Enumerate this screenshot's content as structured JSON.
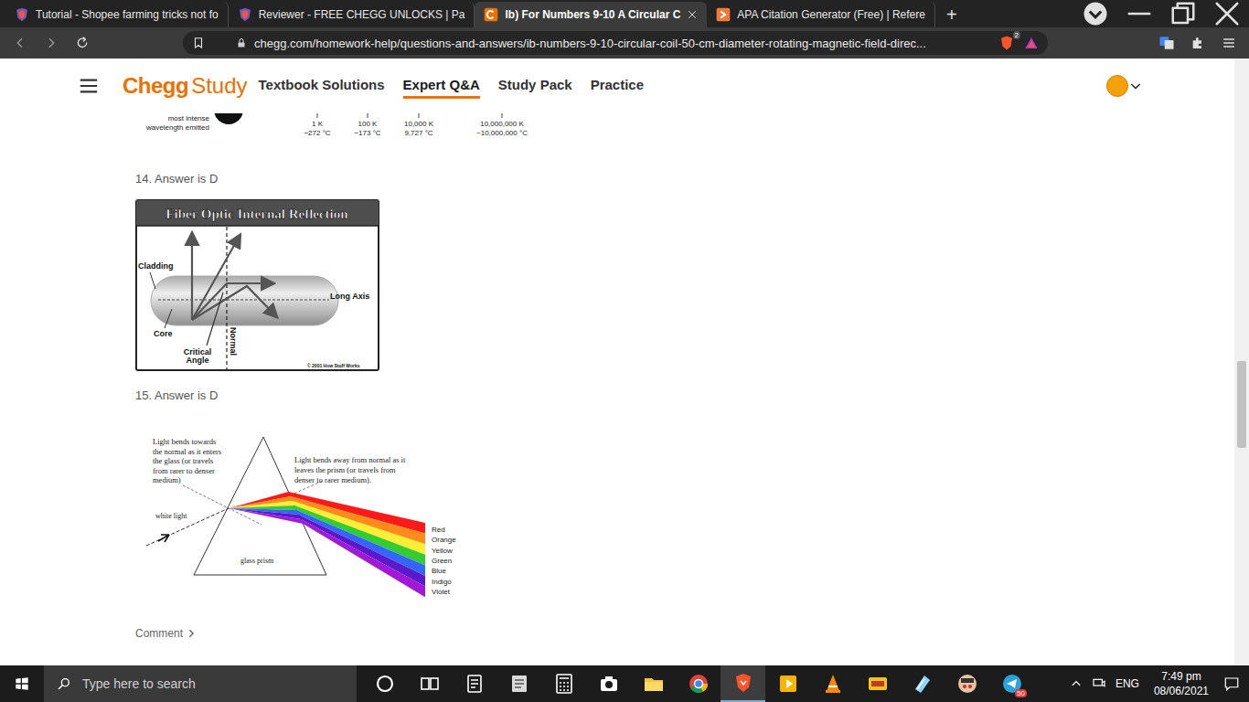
{
  "browser": {
    "tabs": [
      {
        "label": "Tutorial - Shopee farming tricks not fo",
        "selected": false,
        "kind": "brave"
      },
      {
        "label": "Reviewer - FREE CHEGG UNLOCKS | Pa",
        "selected": false,
        "kind": "brave"
      },
      {
        "label": "Ib) For Numbers 9-10 A Circular C",
        "selected": true,
        "kind": "chegg"
      },
      {
        "label": "APA Citation Generator (Free) | Refere",
        "selected": false,
        "kind": "scribbr"
      }
    ],
    "new_tab": "+",
    "url": "chegg.com/homework-help/questions-and-answers/ib-numbers-9-10-circular-coil-50-cm-diameter-rotating-magnetic-field-direc...",
    "shield_badge": "2"
  },
  "header": {
    "logo": "Chegg",
    "logo_sub": "Study",
    "nav": [
      {
        "label": "Textbook Solutions",
        "selected": false
      },
      {
        "label": "Expert Q&A",
        "selected": true
      },
      {
        "label": "Study Pack",
        "selected": false
      },
      {
        "label": "Practice",
        "selected": false
      }
    ]
  },
  "content": {
    "spectrum": {
      "caption": [
        "most intense",
        "wavelength emitted"
      ],
      "ticks": [
        {
          "kelvin": "1 K",
          "celsius": "−272 °C"
        },
        {
          "kelvin": "100 K",
          "celsius": "−173 °C"
        },
        {
          "kelvin": "10,000 K",
          "celsius": "9,727 °C"
        },
        {
          "kelvin": "10,000,000 K",
          "celsius": "~10,000,000 °C"
        }
      ]
    },
    "answers": [
      {
        "label": "14. Answer is D"
      },
      {
        "label": "15. Answer is D"
      }
    ],
    "fiber_figure": {
      "title": "Fiber Optic Internal Reflection",
      "cladding": "Cladding",
      "core": "Core",
      "critical_angle": [
        "Critical",
        "Angle"
      ],
      "normal": "Normal",
      "long_axis": "Long Axis",
      "credit": "© 2001 How Stuff Works"
    },
    "prism_figure": {
      "enter_note": [
        "Light bends towards",
        "the normal as it enters",
        "the glass (or travels",
        "from rarer to denser",
        "medium)"
      ],
      "exit_note": [
        "Light bends away from normal as it",
        "leaves the prism (or travels from",
        "denser to rarer medium)."
      ],
      "white_light": "white light",
      "prism": "glass prism",
      "colors": [
        {
          "name": "Red",
          "color": "#ff1a1a"
        },
        {
          "name": "Orange",
          "color": "#ff8c1a"
        },
        {
          "name": "Yellow",
          "color": "#ffee33"
        },
        {
          "name": "Green",
          "color": "#33cc33"
        },
        {
          "name": "Blue",
          "color": "#3366ff"
        },
        {
          "name": "Indigo",
          "color": "#5a1acc"
        },
        {
          "name": "Violet",
          "color": "#a01ad6"
        }
      ]
    },
    "comment": "Comment"
  },
  "taskbar": {
    "search_placeholder": "Type here to search",
    "apps": [
      {
        "kind": "cortana",
        "selected": false
      },
      {
        "kind": "taskview",
        "selected": false
      },
      {
        "kind": "reader",
        "selected": false
      },
      {
        "kind": "dictionary",
        "selected": false
      },
      {
        "kind": "calculator",
        "selected": false
      },
      {
        "kind": "camera",
        "selected": false
      },
      {
        "kind": "folder",
        "selected": false
      },
      {
        "kind": "chrome",
        "selected": false
      },
      {
        "kind": "brave",
        "selected": true
      },
      {
        "kind": "player",
        "selected": false
      },
      {
        "kind": "vlc",
        "selected": false
      },
      {
        "kind": "pdf",
        "selected": false
      },
      {
        "kind": "notes",
        "selected": false
      },
      {
        "kind": "game",
        "selected": false
      },
      {
        "kind": "telegram",
        "selected": false
      }
    ],
    "telegram_badge": "50",
    "tray_lang": "ENG",
    "time": "7:49 pm",
    "date": "08/06/2021"
  }
}
